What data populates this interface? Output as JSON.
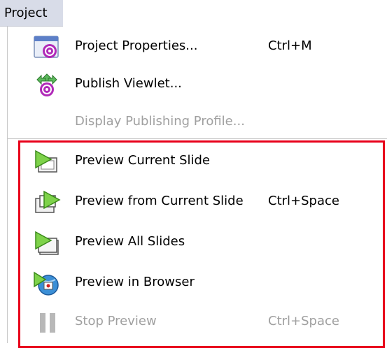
{
  "menubar": {
    "title": "Project"
  },
  "menu": {
    "items": [
      {
        "label": "Project Properties...",
        "shortcut": "Ctrl+M",
        "icon": "project-properties-icon",
        "enabled": true
      },
      {
        "label": "Publish Viewlet...",
        "shortcut": "",
        "icon": "publish-viewlet-icon",
        "enabled": true
      },
      {
        "label": "Display Publishing Profile...",
        "shortcut": "",
        "icon": "",
        "enabled": false
      },
      {
        "label": "Preview Current Slide",
        "shortcut": "",
        "icon": "preview-current-slide-icon",
        "enabled": true
      },
      {
        "label": "Preview from Current Slide",
        "shortcut": "Ctrl+Space",
        "icon": "preview-from-current-slide-icon",
        "enabled": true
      },
      {
        "label": "Preview All Slides",
        "shortcut": "",
        "icon": "preview-all-slides-icon",
        "enabled": true
      },
      {
        "label": "Preview in Browser",
        "shortcut": "",
        "icon": "preview-in-browser-icon",
        "enabled": true
      },
      {
        "label": "Stop Preview",
        "shortcut": "Ctrl+Space",
        "icon": "pause-icon",
        "enabled": false
      }
    ]
  },
  "colors": {
    "highlight_border": "#e8001a",
    "disabled_text": "#a0a0a0",
    "menubar_bg": "#d8dce8"
  }
}
